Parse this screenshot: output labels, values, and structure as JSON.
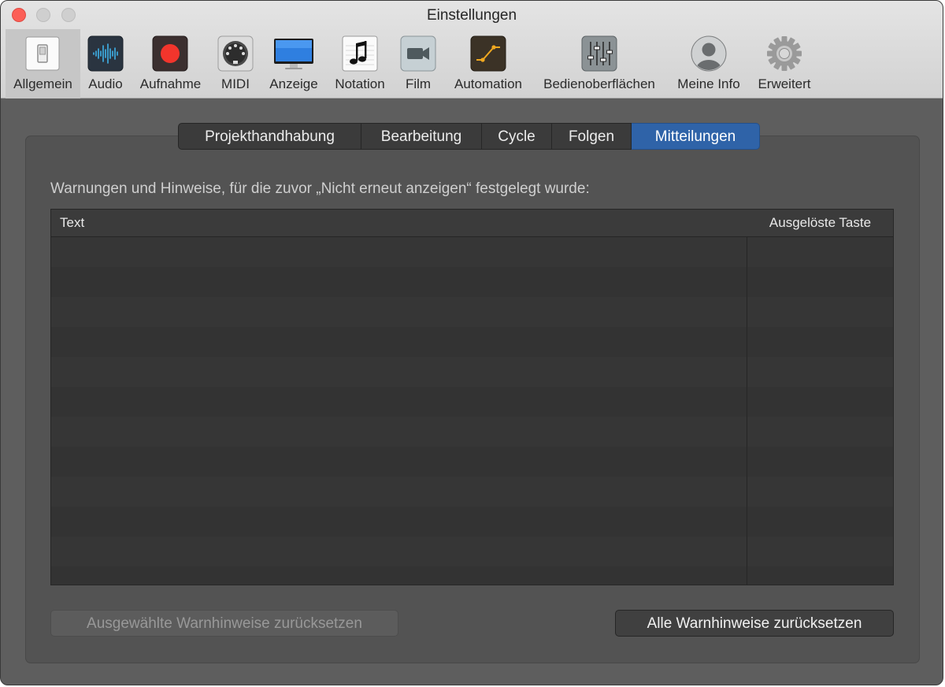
{
  "window": {
    "title": "Einstellungen"
  },
  "toolbar": {
    "items": [
      {
        "label": "Allgemein",
        "icon": "general-switch-icon",
        "selected": true
      },
      {
        "label": "Audio",
        "icon": "audio-waveform-icon"
      },
      {
        "label": "Aufnahme",
        "icon": "record-icon"
      },
      {
        "label": "MIDI",
        "icon": "midi-connector-icon"
      },
      {
        "label": "Anzeige",
        "icon": "display-monitor-icon"
      },
      {
        "label": "Notation",
        "icon": "music-note-icon"
      },
      {
        "label": "Film",
        "icon": "video-camera-icon"
      },
      {
        "label": "Automation",
        "icon": "automation-curve-icon"
      },
      {
        "label": "Bedienoberflächen",
        "icon": "mixer-faders-icon"
      },
      {
        "label": "Meine Info",
        "icon": "user-avatar-icon"
      },
      {
        "label": "Erweitert",
        "icon": "gear-icon"
      }
    ]
  },
  "tabs": [
    {
      "label": "Projekthandhabung"
    },
    {
      "label": "Bearbeitung"
    },
    {
      "label": "Cycle"
    },
    {
      "label": "Folgen"
    },
    {
      "label": "Mitteilungen",
      "active": true
    }
  ],
  "content": {
    "description": "Warnungen und Hinweise, für die zuvor „Nicht erneut anzeigen“ festgelegt wurde:",
    "table": {
      "columns": [
        "Text",
        "Ausgelöste Taste"
      ],
      "rows": []
    },
    "buttons": {
      "reset_selected": "Ausgewählte Warnhinweise zurücksetzen",
      "reset_all": "Alle Warnhinweise zurücksetzen"
    }
  },
  "colors": {
    "accent": "#2f63a8",
    "panel_background": "#535353",
    "window_background": "#5e5e5e"
  }
}
